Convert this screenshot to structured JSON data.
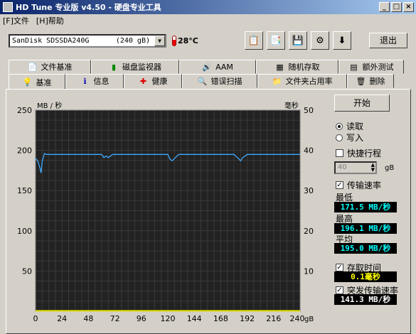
{
  "window": {
    "title": "HD Tune 专业版 v4.50 - 硬盘专业工具",
    "min": "_",
    "max": "□",
    "close": "×"
  },
  "menu": {
    "file": "[F]文件",
    "help": "[H]帮助"
  },
  "toolbar": {
    "drive_name": "SanDisk SDSSDA240G",
    "drive_size": "(240 gB)",
    "temperature": "28°C",
    "exit_label": "退出",
    "buttons": [
      "copy-text-icon",
      "copy-image-icon",
      "save-icon",
      "options-icon",
      "down-arrow-icon"
    ]
  },
  "tabs_top": [
    {
      "label": "文件基准",
      "icon": "file-benchmark-icon"
    },
    {
      "label": "磁盘监视器",
      "icon": "disk-monitor-icon"
    },
    {
      "label": "AAM",
      "icon": "speaker-icon"
    },
    {
      "label": "随机存取",
      "icon": "random-access-icon"
    },
    {
      "label": "额外测试",
      "icon": "extra-tests-icon"
    }
  ],
  "tabs_bottom": [
    {
      "label": "基准",
      "icon": "benchmark-icon"
    },
    {
      "label": "信息",
      "icon": "info-icon"
    },
    {
      "label": "健康",
      "icon": "health-icon"
    },
    {
      "label": "错误扫描",
      "icon": "error-scan-icon"
    },
    {
      "label": "文件夹占用率",
      "icon": "folder-usage-icon"
    },
    {
      "label": "删除",
      "icon": "erase-icon"
    }
  ],
  "side": {
    "start_label": "开始",
    "read_label": "读取",
    "write_label": "写入",
    "mode_selected": "read",
    "short_stroke_label": "快捷行程",
    "short_stroke_checked": false,
    "short_stroke_value": "40",
    "short_stroke_unit": "gB",
    "transfer_rate_label": "传输速率",
    "transfer_rate_checked": true,
    "min_label": "最低",
    "min_value": "171.5 MB/秒",
    "max_label": "最高",
    "max_value": "196.1 MB/秒",
    "avg_label": "平均",
    "avg_value": "195.0 MB/秒",
    "access_time_label": "存取时间",
    "access_time_checked": true,
    "access_time_value": "0.1毫秒",
    "burst_rate_label": "突发传输速率",
    "burst_rate_checked": true,
    "burst_rate_value": "141.3 MB/秒"
  },
  "chart_data": {
    "type": "line",
    "ylabel_left": "MB / 秒",
    "ylabel_right": "毫秒",
    "ylim_left": [
      0,
      250
    ],
    "ylim_right": [
      0,
      50
    ],
    "xlim": [
      0,
      240
    ],
    "x_ticks": [
      "0",
      "24",
      "48",
      "72",
      "96",
      "120",
      "144",
      "168",
      "192",
      "216",
      "240"
    ],
    "x_unit": "gB",
    "y_ticks_left": [
      "250",
      "200",
      "150",
      "100",
      "50"
    ],
    "y_ticks_right": [
      "50",
      "40",
      "30",
      "20",
      "10"
    ],
    "grid": true,
    "series": [
      {
        "axis": "left",
        "color": "#3fa9ff",
        "x": [
          0,
          2,
          4,
          5,
          6,
          8,
          10,
          12,
          30,
          60,
          62,
          64,
          66,
          70,
          90,
          120,
          122,
          124,
          126,
          130,
          150,
          180,
          184,
          186,
          188,
          192,
          200,
          220,
          240
        ],
        "y": [
          190,
          187,
          178,
          172,
          186,
          196,
          195,
          195,
          195,
          195,
          191,
          193,
          191,
          195,
          195,
          195,
          189,
          187,
          190,
          195,
          195,
          195,
          190,
          187,
          191,
          195,
          195,
          195,
          195
        ]
      },
      {
        "axis": "right",
        "color": "#e6e600",
        "x": [
          0,
          240
        ],
        "y": [
          0.1,
          0.1
        ]
      }
    ]
  }
}
